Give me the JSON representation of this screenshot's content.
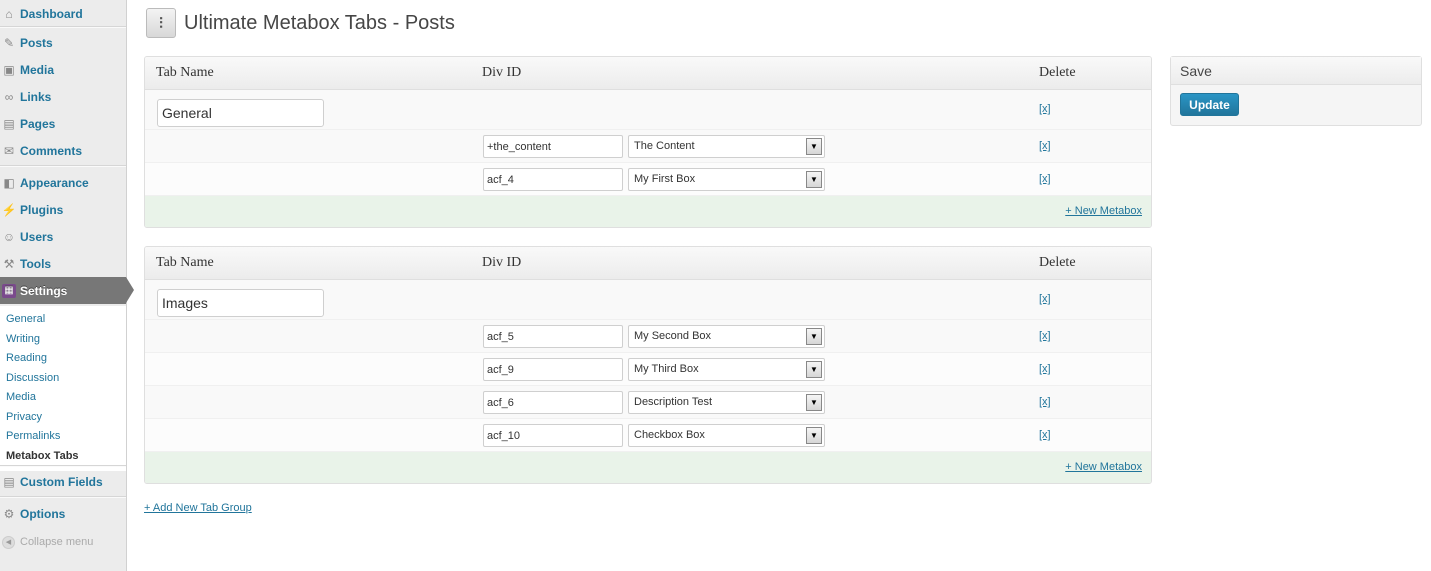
{
  "sidebar": {
    "items": [
      {
        "label": "Dashboard",
        "icon": "dashboard-icon",
        "glyph": "⌂"
      },
      {
        "label": "Posts",
        "icon": "pin-icon",
        "glyph": "✎"
      },
      {
        "label": "Media",
        "icon": "media-icon",
        "glyph": "▣"
      },
      {
        "label": "Links",
        "icon": "links-icon",
        "glyph": "∞"
      },
      {
        "label": "Pages",
        "icon": "pages-icon",
        "glyph": "▤"
      },
      {
        "label": "Comments",
        "icon": "comments-icon",
        "glyph": "✉"
      },
      {
        "label": "Appearance",
        "icon": "appearance-icon",
        "glyph": "◧"
      },
      {
        "label": "Plugins",
        "icon": "plugins-icon",
        "glyph": "⚡"
      },
      {
        "label": "Users",
        "icon": "users-icon",
        "glyph": "☺"
      },
      {
        "label": "Tools",
        "icon": "tools-icon",
        "glyph": "⚒"
      },
      {
        "label": "Settings",
        "icon": "settings-icon",
        "glyph": "▦"
      },
      {
        "label": "Custom Fields",
        "icon": "custom-fields-icon",
        "glyph": "▤"
      },
      {
        "label": "Options",
        "icon": "options-icon",
        "glyph": "⚙"
      }
    ],
    "submenu": [
      "General",
      "Writing",
      "Reading",
      "Discussion",
      "Media",
      "Privacy",
      "Permalinks",
      "Metabox Tabs"
    ],
    "collapse_label": "Collapse menu"
  },
  "page": {
    "title": "Ultimate Metabox Tabs - Posts"
  },
  "table_headers": {
    "tab_name": "Tab Name",
    "div_id": "Div ID",
    "delete": "Delete"
  },
  "groups": [
    {
      "tab_name": "General",
      "delete_label": "[x]",
      "metaboxes": [
        {
          "div_id": "+the_content",
          "box": "The Content",
          "delete_label": "[x]"
        },
        {
          "div_id": "acf_4",
          "box": "My First Box",
          "delete_label": "[x]"
        }
      ],
      "new_metabox_label": "+ New Metabox"
    },
    {
      "tab_name": "Images",
      "delete_label": "[x]",
      "metaboxes": [
        {
          "div_id": "acf_5",
          "box": "My Second Box",
          "delete_label": "[x]"
        },
        {
          "div_id": "acf_9",
          "box": "My Third Box",
          "delete_label": "[x]"
        },
        {
          "div_id": "acf_6",
          "box": "Description Test",
          "delete_label": "[x]"
        },
        {
          "div_id": "acf_10",
          "box": "Checkbox Box",
          "delete_label": "[x]"
        }
      ],
      "new_metabox_label": "+ New Metabox"
    }
  ],
  "add_group_label": "+ Add New Tab Group",
  "savebox": {
    "title": "Save",
    "button_label": "Update"
  },
  "colors": {
    "link": "#21759b",
    "current_menu_bg": "#777777",
    "footer_bg": "#e9f3e9",
    "button": "#21759b"
  }
}
